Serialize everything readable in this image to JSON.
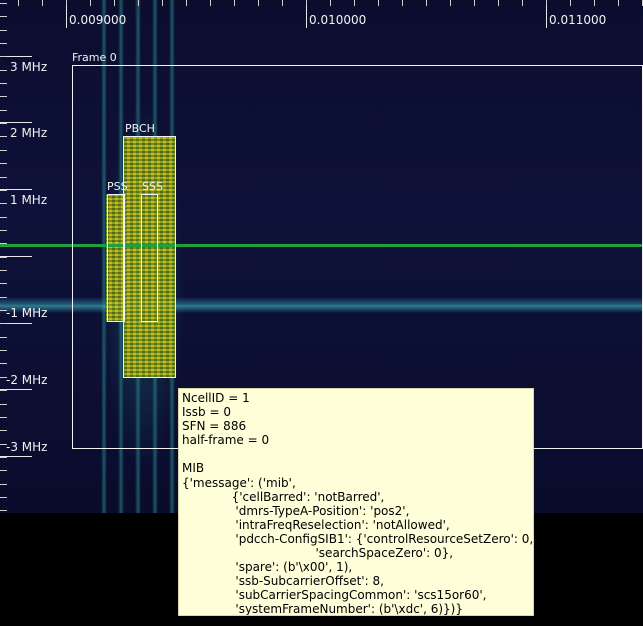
{
  "time_axis": {
    "labels": [
      "0.009000",
      "0.010000",
      "0.011000"
    ]
  },
  "freq_axis": {
    "labels": [
      "3 MHz",
      "2 MHz",
      "1 MHz",
      "-1 MHz",
      "-2 MHz",
      "-3 MHz"
    ]
  },
  "overlays": {
    "frame": "Frame 0",
    "pbch": "PBCH",
    "pss": "PSS",
    "sss": "SSS"
  },
  "info": {
    "lines": [
      "NcellID = 1",
      "Issb = 0",
      "SFN = 886",
      "half-frame = 0",
      "",
      "MIB",
      "{'message': ('mib',",
      "             {'cellBarred': 'notBarred',",
      "              'dmrs-TypeA-Position': 'pos2',",
      "              'intraFreqReselection': 'notAllowed',",
      "              'pdcch-ConfigSIB1': {'controlResourceSetZero': 0,",
      "                                   'searchSpaceZero': 0},",
      "              'spare': (b'\\x00', 1),",
      "              'ssb-SubcarrierOffset': 8,",
      "              'subCarrierSpacingCommon': 'scs15or60',",
      "              'systemFrameNumber': (b'\\xdc', 6)})}"
    ]
  },
  "colors": {
    "background": "#0d1036",
    "dc_line": "#1fa03a",
    "overlay": "#f2f2f2",
    "ssb": "#e6dc28",
    "tooltip_bg": "#fefed9"
  }
}
